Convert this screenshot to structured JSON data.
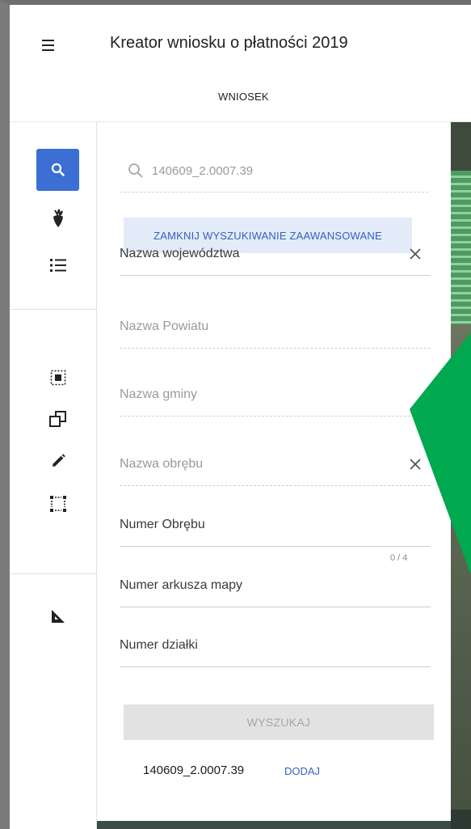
{
  "header": {
    "title": "Kreator wniosku o płatności 2019",
    "tab_label": "WNIOSEK"
  },
  "search": {
    "value": "140609_2.0007.39",
    "advanced_toggle_label": "ZAMKNIJ WYSZUKIWANIE ZAAWANSOWANE"
  },
  "fields": {
    "wojewodztwo": "Nazwa województwa",
    "powiat": "Nazwa Powiatu",
    "gmina": "Nazwa gminy",
    "obreb_name": "Nazwa obrębu",
    "obreb_number": "Numer Obrębu",
    "obreb_counter": "0 / 4",
    "arkusz": "Numer arkusza mapy",
    "dzialka": "Numer działki"
  },
  "actions": {
    "search_label": "WYSZUKAJ",
    "result_id": "140609_2.0007.39",
    "add_label": "DODAJ"
  },
  "colors": {
    "accent": "#3b6fd4",
    "arrow": "#00a84f"
  },
  "rail": {
    "icons": [
      "search-icon",
      "beet-icon",
      "list-icon",
      "select-square-icon",
      "copy-shape-icon",
      "pencil-icon",
      "bounding-box-icon",
      "ruler-triangle-icon"
    ]
  }
}
